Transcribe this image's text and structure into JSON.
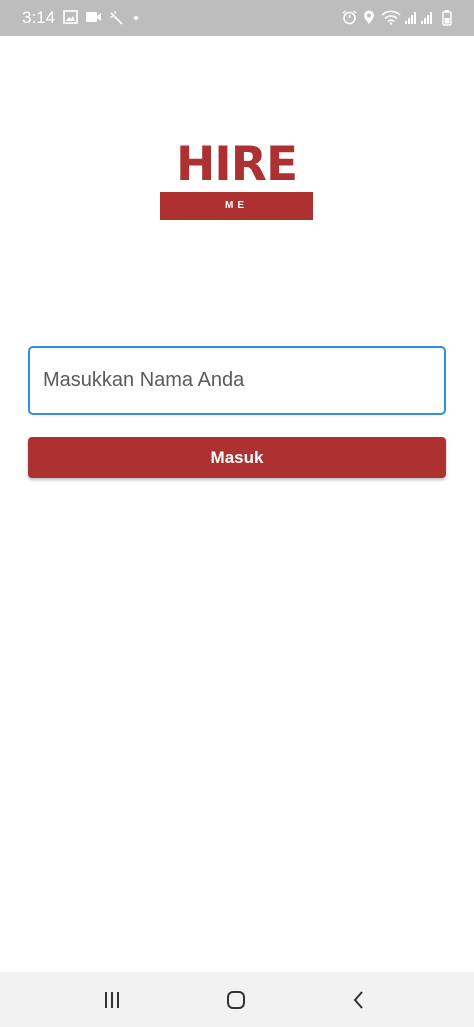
{
  "status_bar": {
    "time": "3:14",
    "left_icons": [
      "image-icon",
      "video-camera-icon",
      "magic-wand-icon",
      "dot-icon"
    ],
    "right_icons": [
      "alarm-icon",
      "location-icon",
      "wifi-icon",
      "signal-icon",
      "signal-icon",
      "battery-icon"
    ]
  },
  "logo": {
    "word": "HIRE",
    "sub": "ME"
  },
  "login": {
    "name_placeholder": "Masukkan Nama Anda",
    "name_value": "",
    "submit_label": "Masuk"
  },
  "nav_bar": {
    "buttons": [
      "recent-apps-icon",
      "home-icon",
      "back-icon"
    ]
  },
  "colors": {
    "brand": "#ad3131",
    "input_focus_border": "#2f8fde",
    "status_bar": "#bdbdbd",
    "nav_bar": "#f2f2f2"
  }
}
